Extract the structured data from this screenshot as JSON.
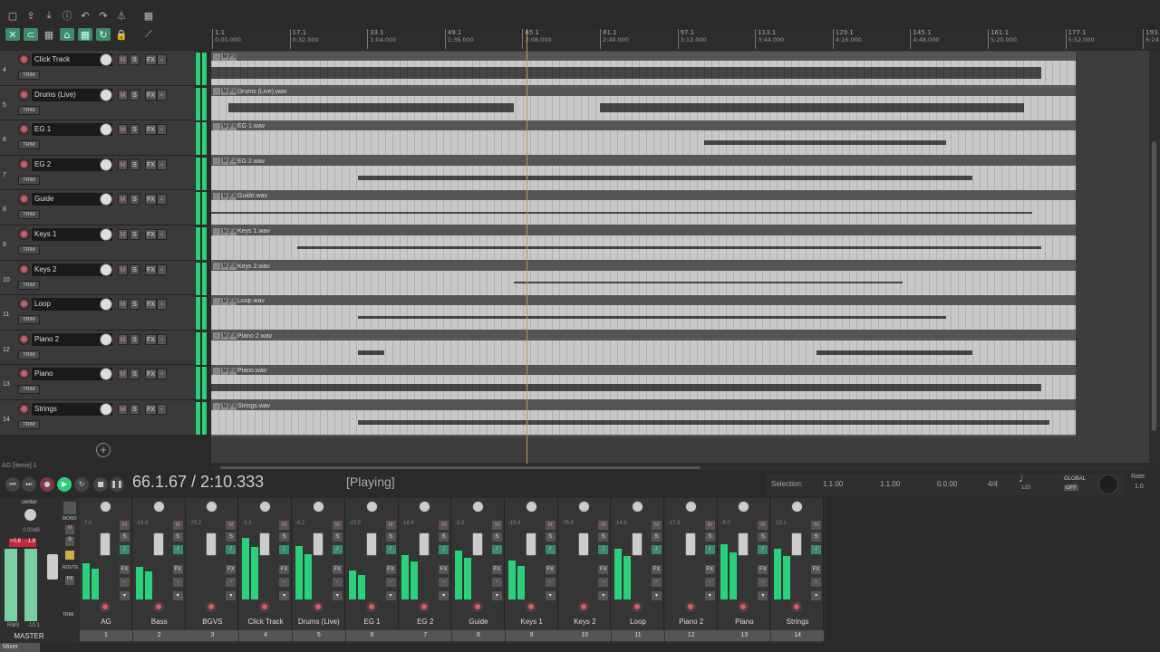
{
  "ruler": {
    "ticks": [
      {
        "bar": "1.1",
        "time": "0:00.000"
      },
      {
        "bar": "17.1",
        "time": "0:32.000"
      },
      {
        "bar": "33.1",
        "time": "1:04.000"
      },
      {
        "bar": "49.1",
        "time": "1:36.000"
      },
      {
        "bar": "65.1",
        "time": "2:08.000"
      },
      {
        "bar": "81.1",
        "time": "2:40.000"
      },
      {
        "bar": "97.1",
        "time": "3:12.000"
      },
      {
        "bar": "113.1",
        "time": "3:44.000"
      },
      {
        "bar": "129.1",
        "time": "4:16.000"
      },
      {
        "bar": "145.1",
        "time": "4:48.000"
      },
      {
        "bar": "161.1",
        "time": "5:20.000"
      },
      {
        "bar": "177.1",
        "time": "5:52.000"
      },
      {
        "bar": "193.",
        "time": "6:24"
      }
    ]
  },
  "tracks": [
    {
      "num": "4",
      "name": "Click Track",
      "item": ""
    },
    {
      "num": "5",
      "name": "Drums (Live)",
      "item": "Drums (Live).wav"
    },
    {
      "num": "6",
      "name": "EG 1",
      "item": "EG 1.wav"
    },
    {
      "num": "7",
      "name": "EG 2",
      "item": "EG 2.wav"
    },
    {
      "num": "8",
      "name": "Guide",
      "item": "Guide.wav"
    },
    {
      "num": "9",
      "name": "Keys 1",
      "item": "Keys 1.wav"
    },
    {
      "num": "10",
      "name": "Keys 2",
      "item": "Keys 2.wav"
    },
    {
      "num": "11",
      "name": "Loop",
      "item": "Loop.wav"
    },
    {
      "num": "12",
      "name": "Piano 2",
      "item": "Piano 2.wav"
    },
    {
      "num": "13",
      "name": "Piano",
      "item": "Piano.wav"
    },
    {
      "num": "14",
      "name": "Strings",
      "item": "Strings.wav"
    }
  ],
  "track_buttons": {
    "mute": "M",
    "solo": "S",
    "fx": "FX",
    "trim": "TRIM"
  },
  "status": {
    "items_label": "AG [items] 1"
  },
  "transport": {
    "position": "66.1.67 / 2:10.333",
    "state": "[Playing]",
    "selection_label": "Selection:",
    "sel_start": "1.1.00",
    "sel_end": "1.1.00",
    "sel_len": "0.0.00",
    "timesig": "4/4",
    "bpm": "120",
    "global_label": "GLOBAL",
    "global_state": "OFF",
    "rate_label": "Rate:",
    "rate": "1.0"
  },
  "master": {
    "pan_label": "center",
    "db": "0.00dB",
    "peak_l": "+0.8",
    "peak_r": "-1.8",
    "rms_label": "RMS",
    "rms": "-10.1",
    "name": "MASTER",
    "mono": "MONO",
    "route": "ROUTE",
    "trim": "TRIM"
  },
  "mixer_strips": [
    {
      "name": "AG",
      "num": "1",
      "db": "-7.0",
      "level": 0.55
    },
    {
      "name": "Bass",
      "num": "2",
      "db": "-14.9",
      "level": 0.5
    },
    {
      "name": "BGVS",
      "num": "3",
      "db": "-70.2",
      "level": 0.0
    },
    {
      "name": "Click Track",
      "num": "4",
      "db": "-3.3",
      "level": 0.95
    },
    {
      "name": "Drums (Live)",
      "num": "5",
      "db": "-8.2",
      "level": 0.82
    },
    {
      "name": "EG 1",
      "num": "6",
      "db": "-23.5",
      "level": 0.45
    },
    {
      "name": "EG 2",
      "num": "7",
      "db": "-18.4",
      "level": 0.68
    },
    {
      "name": "Guide",
      "num": "8",
      "db": "-3.3",
      "level": 0.75
    },
    {
      "name": "Keys 1",
      "num": "9",
      "db": "-19.4",
      "level": 0.6
    },
    {
      "name": "Keys 2",
      "num": "10",
      "db": "-76.8",
      "level": 0.0
    },
    {
      "name": "Loop",
      "num": "11",
      "db": "-14.8",
      "level": 0.78
    },
    {
      "name": "Piano 2",
      "num": "12",
      "db": "-17.3",
      "level": 0.0
    },
    {
      "name": "Piano",
      "num": "13",
      "db": "-9.0",
      "level": 0.85
    },
    {
      "name": "Strings",
      "num": "14",
      "db": "-13.1",
      "level": 0.78
    }
  ],
  "mixer_tab": "Mixer",
  "colors": {
    "meter": "#2ad07a",
    "accent": "#3f8a6a",
    "cursor": "#b89a4a",
    "wave_bg": "#c8c8c8"
  }
}
